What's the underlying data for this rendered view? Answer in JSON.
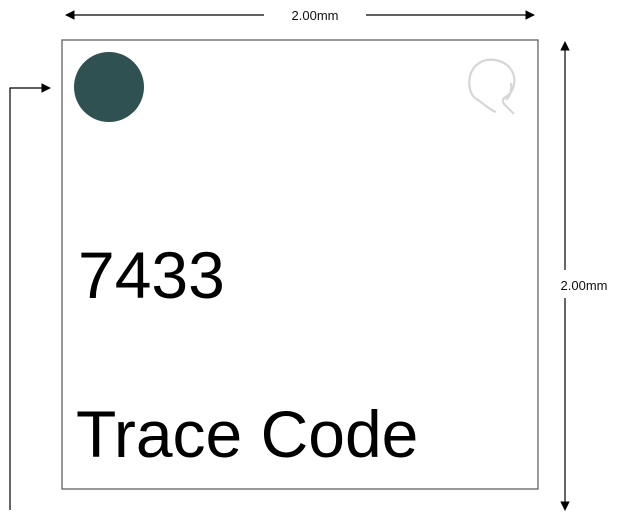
{
  "dimensions": {
    "width_label": "2.00mm",
    "height_label": "2.00mm"
  },
  "package": {
    "part_number": "7433",
    "trace_code": "Trace Code",
    "pin1_dot_color": "#2f5152",
    "logo_icon": "q-logo-icon",
    "outline_color": "#555555"
  }
}
